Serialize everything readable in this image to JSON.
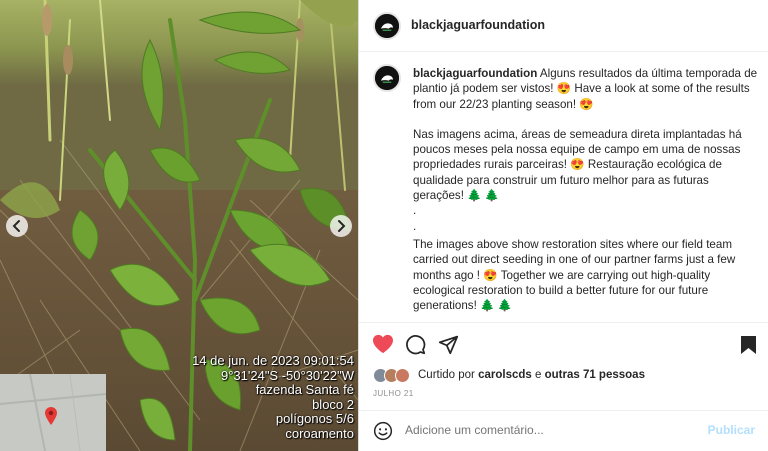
{
  "post": {
    "username": "blackjaguarfoundation",
    "caption": {
      "line1": "Alguns resultados da última temporada de plantio já podem ser vistos! 😍 Have a look at some of the results from our 22/23 planting season! 😍",
      "line2": "Nas imagens acima, áreas de semeadura direta implantadas há poucos meses pela nossa equipe de campo em uma de nossas propriedades rurais parceiras! 😍 Restauração ecológica de qualidade para construir um futuro melhor para as futuras gerações! 🌲 🌲",
      "dot1": ".",
      "dot2": ".",
      "line3": "The images above show restoration sites where our field team carried out direct seeding in one of our partner farms just a few months ago ! 😍 Together we are carrying out high-quality ecological restoration to build a better future for our future generations! 🌲 🌲"
    },
    "likes_prefix": "Curtido por",
    "likes_user": "carolscds",
    "likes_conj": "e",
    "likes_others": "outras 71 pessoas",
    "date": "JULHO 21",
    "comment_placeholder": "Adicione um comentário...",
    "publish_label": "Publicar"
  },
  "photo_stamp": {
    "line1": "14 de jun. de 2023 09:01:54",
    "line2": "9°31'24\"S -50°30'22\"W",
    "line3": "fazenda Santa fé",
    "line4": "bloco 2",
    "line5": "polígonos 5/6",
    "line6": "coroamento"
  },
  "icons": {
    "like": "heart-icon",
    "comment": "comment-icon",
    "share": "paper-plane-icon",
    "save": "bookmark-icon",
    "emoji": "smiley-icon",
    "prev": "chevron-left-icon",
    "next": "chevron-right-icon",
    "map_pin": "map-pin-icon"
  },
  "colors": {
    "like_red": "#ed4956",
    "publish_blue": "#b2dffc",
    "muted": "#8e8e8e"
  }
}
